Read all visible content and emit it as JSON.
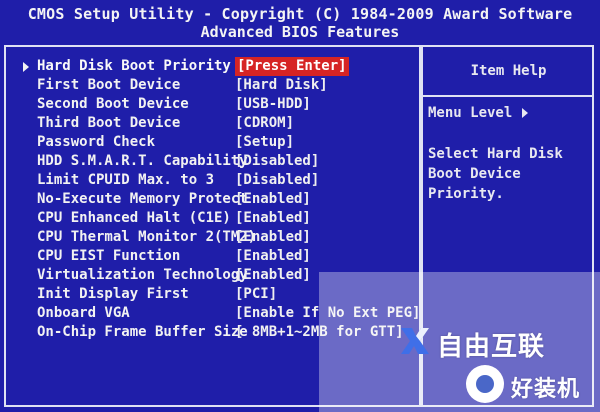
{
  "header": {
    "title": "CMOS Setup Utility - Copyright (C) 1984-2009 Award Software",
    "subtitle": "Advanced BIOS Features"
  },
  "menu": {
    "items": [
      {
        "label": "Hard Disk Boot Priority",
        "value": "[Press Enter]",
        "selected": true
      },
      {
        "label": "First Boot Device",
        "value": "[Hard Disk]"
      },
      {
        "label": "Second Boot Device",
        "value": "[USB-HDD]"
      },
      {
        "label": "Third Boot Device",
        "value": "[CDROM]"
      },
      {
        "label": "Password Check",
        "value": "[Setup]"
      },
      {
        "label": "HDD S.M.A.R.T. Capability",
        "value": "[Disabled]"
      },
      {
        "label": "Limit CPUID Max. to 3",
        "value": "[Disabled]"
      },
      {
        "label": "No-Execute Memory Protect",
        "value": "[Enabled]"
      },
      {
        "label": "CPU Enhanced Halt (C1E)",
        "value": "[Enabled]"
      },
      {
        "label": "CPU Thermal Monitor 2(TM2)",
        "value": "[Enabled]"
      },
      {
        "label": "CPU EIST Function",
        "value": "[Enabled]"
      },
      {
        "label": "Virtualization Technology",
        "value": "[Enabled]"
      },
      {
        "label": "Init Display First",
        "value": "[PCI]"
      },
      {
        "label": "Onboard VGA",
        "value": "[Enable If No Ext PEG]"
      },
      {
        "label": "On-Chip Frame Buffer Size",
        "value": "[ 8MB+1~2MB for GTT]"
      }
    ]
  },
  "help": {
    "title": "Item Help",
    "menu_level": "Menu Level",
    "text": "Select Hard Disk Boot Device Priority."
  },
  "watermark": {
    "line1": "自由互联",
    "line2": "好装机"
  },
  "colors": {
    "background": "#1f1ea9",
    "highlight": "#d62424",
    "text": "#f2f2f2"
  }
}
